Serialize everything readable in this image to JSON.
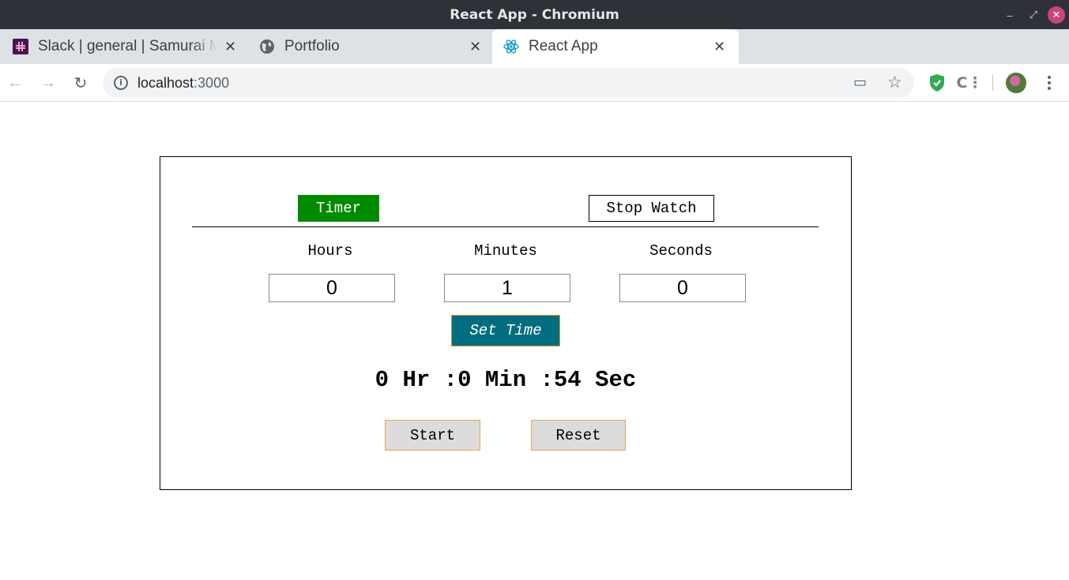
{
  "window": {
    "title": "React App - Chromium"
  },
  "tabs": [
    {
      "label": "Slack | general | Samurai Manga",
      "icon": "slack-icon",
      "active": false
    },
    {
      "label": "Portfolio",
      "icon": "globe-icon",
      "active": false
    },
    {
      "label": "React App",
      "icon": "react-icon",
      "active": true
    }
  ],
  "toolbar": {
    "url_host": "localhost",
    "url_port": ":3000"
  },
  "app": {
    "mode_tabs": {
      "timer": "Timer",
      "stopwatch": "Stop Watch"
    },
    "active_mode": "Timer",
    "labels": {
      "hours": "Hours",
      "minutes": "Minutes",
      "seconds": "Seconds"
    },
    "inputs": {
      "hours": "0",
      "minutes": "1",
      "seconds": "0"
    },
    "set_time_label": "Set Time",
    "readout": "0 Hr :0 Min :54 Sec",
    "buttons": {
      "start": "Start",
      "reset": "Reset"
    }
  },
  "colors": {
    "timer_active": "#008a00",
    "set_time_bg": "#006e7f",
    "button_border": "#e8a552"
  }
}
